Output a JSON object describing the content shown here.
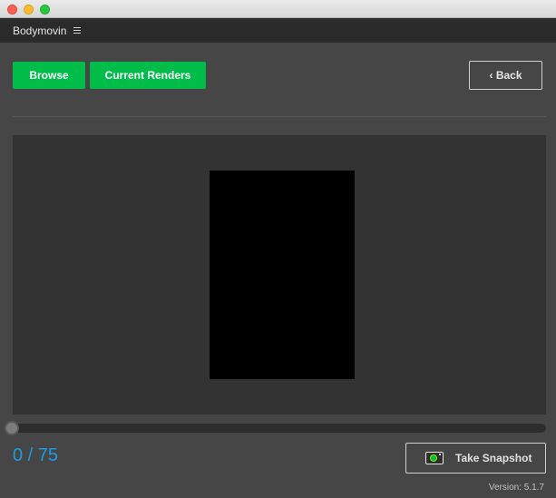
{
  "panel": {
    "title": "Bodymovin"
  },
  "toolbar": {
    "browse_label": "Browse",
    "current_renders_label": "Current Renders",
    "back_label": "‹ Back"
  },
  "player": {
    "frame_counter": "0 / 75",
    "current_frame": 0,
    "total_frames": 75,
    "snapshot_label": "Take Snapshot"
  },
  "footer": {
    "version": "Version: 5.1.7"
  },
  "colors": {
    "accent_green": "#00bd4a",
    "frame_counter_blue": "#1e9be0",
    "panel_background": "#464646",
    "preview_background": "#333333",
    "canvas_background": "#000000"
  },
  "icons": {
    "panel_menu": "hamburger-icon",
    "snapshot": "camera-icon"
  }
}
